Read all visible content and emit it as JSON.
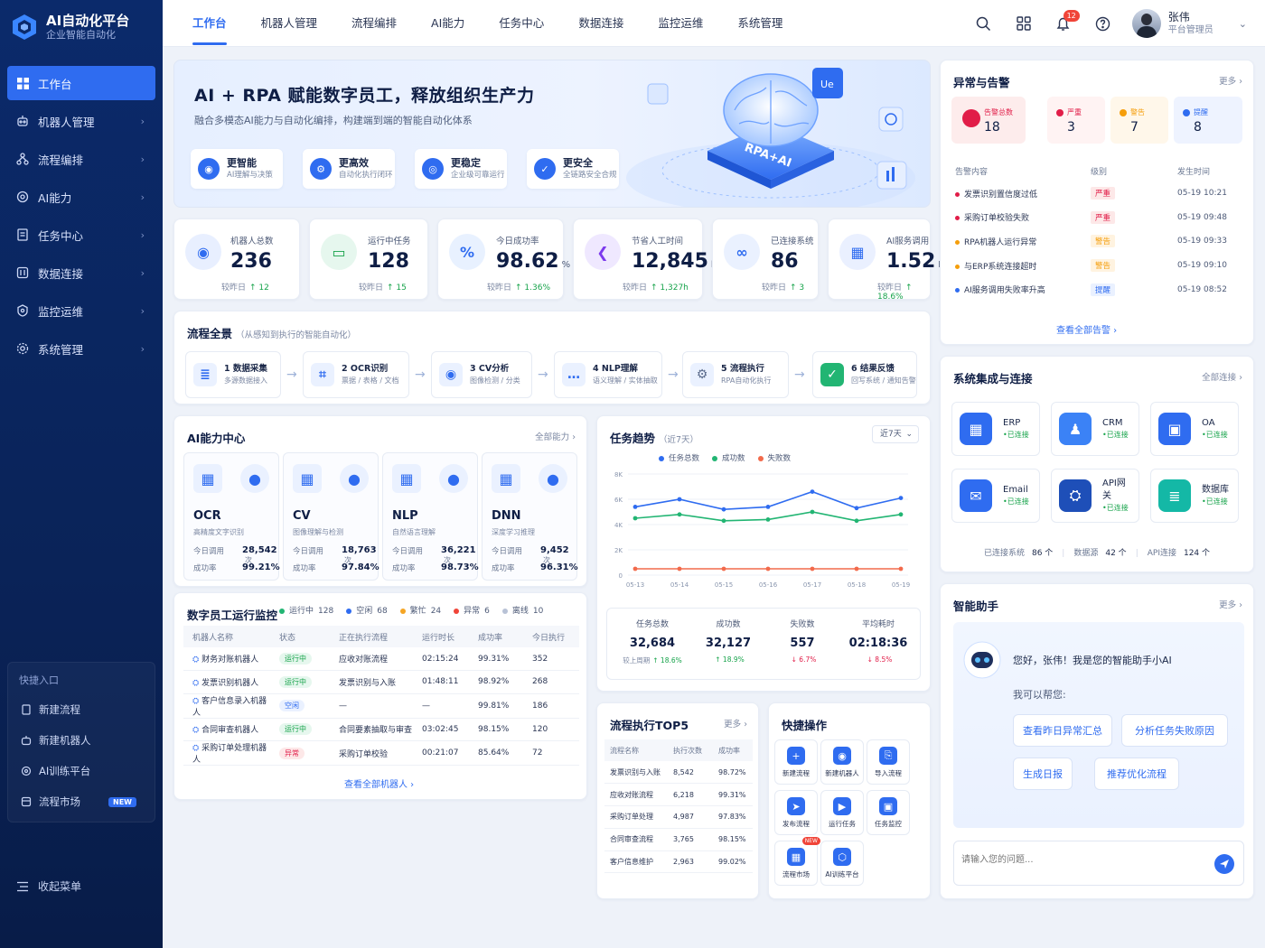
{
  "brand": {
    "title": "AI自动化平台",
    "subtitle": "企业智能自动化"
  },
  "sidebar": {
    "items": [
      {
        "label": "工作台",
        "icon": "dashboard-icon",
        "active": true
      },
      {
        "label": "机器人管理",
        "icon": "robot-icon"
      },
      {
        "label": "流程编排",
        "icon": "workflow-icon"
      },
      {
        "label": "AI能力",
        "icon": "ai-gear-icon"
      },
      {
        "label": "任务中心",
        "icon": "task-icon"
      },
      {
        "label": "数据连接",
        "icon": "data-icon"
      },
      {
        "label": "监控运维",
        "icon": "monitor-icon"
      },
      {
        "label": "系统管理",
        "icon": "settings-icon"
      }
    ],
    "quick_title": "快捷入口",
    "quick": [
      {
        "label": "新建流程"
      },
      {
        "label": "新建机器人"
      },
      {
        "label": "AI训练平台"
      },
      {
        "label": "流程市场",
        "badge": "NEW"
      }
    ],
    "collapse": "收起菜单"
  },
  "topnav": {
    "tabs": [
      "工作台",
      "机器人管理",
      "流程编排",
      "AI能力",
      "任务中心",
      "数据连接",
      "监控运维",
      "系统管理"
    ],
    "notif_count": "12",
    "user_name": "张伟",
    "user_role": "平台管理员"
  },
  "hero": {
    "title": "AI + RPA 赋能数字员工，释放组织生产力",
    "subtitle": "融合多模态AI能力与自动化编排，构建端到端的智能自动化体系",
    "badge": "RPA+AI",
    "chip": "Ue",
    "features": [
      {
        "title": "更智能",
        "desc": "AI理解与决策"
      },
      {
        "title": "更高效",
        "desc": "自动化执行闭环"
      },
      {
        "title": "更稳定",
        "desc": "企业级可靠运行"
      },
      {
        "title": "更安全",
        "desc": "全链路安全合规"
      }
    ]
  },
  "stats": [
    {
      "label": "机器人总数",
      "value": "236",
      "unit": "",
      "cmp": "较昨日",
      "delta": "↑ 12"
    },
    {
      "label": "运行中任务",
      "value": "128",
      "unit": "",
      "cmp": "较昨日",
      "delta": "↑ 15"
    },
    {
      "label": "今日成功率",
      "value": "98.62",
      "unit": "%",
      "cmp": "较昨日",
      "delta": "↑ 1.36%"
    },
    {
      "label": "节省人工时间",
      "value": "12,845",
      "unit": "h",
      "cmp": "较昨日",
      "delta": "↑ 1,327h"
    },
    {
      "label": "已连接系统",
      "value": "86",
      "unit": "",
      "cmp": "较昨日",
      "delta": "↑ 3"
    },
    {
      "label": "AI服务调用",
      "value": "1.52",
      "unit": "M",
      "cmp": "较昨日",
      "delta": "↑ 18.6%"
    }
  ],
  "flow": {
    "title": "流程全景",
    "note": "（从感知到执行的智能自动化）",
    "steps": [
      {
        "title": "1 数据采集",
        "desc": "多源数据接入"
      },
      {
        "title": "2 OCR识别",
        "desc": "票据 / 表格 / 文档"
      },
      {
        "title": "3 CV分析",
        "desc": "图像检测 / 分类"
      },
      {
        "title": "4 NLP理解",
        "desc": "语义理解 / 实体抽取"
      },
      {
        "title": "5 流程执行",
        "desc": "RPA自动化执行"
      },
      {
        "title": "6 结果反馈",
        "desc": "回写系统 / 通知告警"
      }
    ]
  },
  "ai": {
    "title": "AI能力中心",
    "more": "全部能力 ›",
    "today_label": "今日调用",
    "rate_label": "成功率",
    "unit": "次",
    "cards": [
      {
        "name": "OCR",
        "desc": "高精度文字识别",
        "calls": "28,542",
        "rate": "99.21%"
      },
      {
        "name": "CV",
        "desc": "图像理解与检测",
        "calls": "18,763",
        "rate": "97.84%"
      },
      {
        "name": "NLP",
        "desc": "自然语言理解",
        "calls": "36,221",
        "rate": "98.73%"
      },
      {
        "name": "DNN",
        "desc": "深度学习推理",
        "calls": "9,452",
        "rate": "96.31%"
      }
    ]
  },
  "trend": {
    "title": "任务趋势",
    "note": "（近7天）",
    "range": "近7天",
    "legend": [
      "任务总数",
      "成功数",
      "失败数"
    ],
    "summary": [
      {
        "label": "任务总数",
        "value": "32,684",
        "cmp": "较上周期",
        "delta": "↑ 18.6%",
        "up": true
      },
      {
        "label": "成功数",
        "value": "32,127",
        "cmp": "",
        "delta": "↑ 18.9%",
        "up": true
      },
      {
        "label": "失败数",
        "value": "557",
        "cmp": "",
        "delta": "↓ 6.7%",
        "up": false
      },
      {
        "label": "平均耗时",
        "value": "02:18:36",
        "cmp": "",
        "delta": "↓ 8.5%",
        "up": true
      }
    ]
  },
  "chart_data": {
    "type": "line",
    "x": [
      "05-13",
      "05-14",
      "05-15",
      "05-16",
      "05-17",
      "05-18",
      "05-19"
    ],
    "yticks": [
      "0",
      "2K",
      "4K",
      "6K",
      "8K"
    ],
    "ylim": [
      0,
      8000
    ],
    "series": [
      {
        "name": "任务总数",
        "color": "#2f6cf0",
        "values": [
          5400,
          6000,
          5200,
          5400,
          6600,
          5300,
          6100
        ]
      },
      {
        "name": "成功数",
        "color": "#22b573",
        "values": [
          4500,
          4800,
          4300,
          4400,
          5000,
          4300,
          4800
        ]
      },
      {
        "name": "失败数",
        "color": "#f26a4b",
        "values": [
          500,
          500,
          500,
          500,
          500,
          500,
          500
        ]
      }
    ]
  },
  "monitor": {
    "title": "数字员工运行监控",
    "legend": [
      {
        "label": "运行中",
        "count": "128",
        "color": "#22b573"
      },
      {
        "label": "空闲",
        "count": "68",
        "color": "#2f6cf0"
      },
      {
        "label": "繁忙",
        "count": "24",
        "color": "#f5a524"
      },
      {
        "label": "异常",
        "count": "6",
        "color": "#f04438"
      },
      {
        "label": "离线",
        "count": "10",
        "color": "#b8c2d6"
      }
    ],
    "columns": [
      "机器人名称",
      "状态",
      "正在执行流程",
      "运行时长",
      "成功率",
      "今日执行"
    ],
    "rows": [
      {
        "name": "财务对账机器人",
        "status": "运行中",
        "kind": "run",
        "flow": "应收对账流程",
        "time": "02:15:24",
        "rate": "99.31%",
        "count": "352"
      },
      {
        "name": "发票识别机器人",
        "status": "运行中",
        "kind": "run",
        "flow": "发票识别与入账",
        "time": "01:48:11",
        "rate": "98.92%",
        "count": "268"
      },
      {
        "name": "客户信息录入机器人",
        "status": "空闲",
        "kind": "idle",
        "flow": "—",
        "time": "—",
        "rate": "99.81%",
        "count": "186"
      },
      {
        "name": "合同审查机器人",
        "status": "运行中",
        "kind": "run",
        "flow": "合同要素抽取与审查",
        "time": "03:02:45",
        "rate": "98.15%",
        "count": "120"
      },
      {
        "name": "采购订单处理机器人",
        "status": "异常",
        "kind": "err",
        "flow": "采购订单校验",
        "time": "00:21:07",
        "rate": "85.64%",
        "count": "72"
      }
    ],
    "link": "查看全部机器人 ›"
  },
  "top5": {
    "title": "流程执行TOP5",
    "more": "更多 ›",
    "columns": [
      "流程名称",
      "执行次数",
      "成功率"
    ],
    "rows": [
      {
        "name": "发票识别与入账",
        "count": "8,542",
        "rate": "98.72%"
      },
      {
        "name": "应收对账流程",
        "count": "6,218",
        "rate": "99.31%"
      },
      {
        "name": "采购订单处理",
        "count": "4,987",
        "rate": "97.83%"
      },
      {
        "name": "合同审查流程",
        "count": "3,765",
        "rate": "98.15%"
      },
      {
        "name": "客户信息维护",
        "count": "2,963",
        "rate": "99.02%"
      }
    ]
  },
  "quick_ops": {
    "title": "快捷操作",
    "items": [
      {
        "label": "新建流程",
        "icon": "add-file-icon"
      },
      {
        "label": "新建机器人",
        "icon": "robot-icon"
      },
      {
        "label": "导入流程",
        "icon": "import-icon"
      },
      {
        "label": "发布流程",
        "icon": "send-icon"
      },
      {
        "label": "运行任务",
        "icon": "play-icon"
      },
      {
        "label": "任务监控",
        "icon": "monitor-icon"
      },
      {
        "label": "流程市场",
        "icon": "market-icon",
        "badge": "NEW"
      },
      {
        "label": "AI训练平台",
        "icon": "ai-train-icon"
      }
    ]
  },
  "alerts": {
    "title": "异常与告警",
    "more": "更多 ›",
    "boxes": [
      {
        "label": "告警总数",
        "value": "18",
        "color": "#e11d48",
        "bg": "#fdecec"
      },
      {
        "label": "严重",
        "value": "3",
        "color": "#e11d48",
        "bg": "#fff3f3"
      },
      {
        "label": "警告",
        "value": "7",
        "color": "#f59e0b",
        "bg": "#fff7ea"
      },
      {
        "label": "提醒",
        "value": "8",
        "color": "#2f6cf0",
        "bg": "#eef3ff"
      }
    ],
    "columns": [
      "告警内容",
      "级别",
      "发生时间"
    ],
    "rows": [
      {
        "text": "发票识别置信度过低",
        "level": "严重",
        "kind": "crit",
        "time": "05-19  10:21"
      },
      {
        "text": "采购订单校验失败",
        "level": "严重",
        "kind": "crit",
        "time": "05-19  09:48"
      },
      {
        "text": "RPA机器人运行异常",
        "level": "警告",
        "kind": "warn",
        "time": "05-19  09:33"
      },
      {
        "text": "与ERP系统连接超时",
        "level": "警告",
        "kind": "warn",
        "time": "05-19  09:10"
      },
      {
        "text": "AI服务调用失败率升高",
        "level": "提醒",
        "kind": "info",
        "time": "05-19  08:52"
      }
    ],
    "link": "查看全部告警 ›"
  },
  "integration": {
    "title": "系统集成与连接",
    "more": "全部连接 ›",
    "status": "•已连接",
    "items": [
      {
        "name": "ERP",
        "color": "#2f6cf0"
      },
      {
        "name": "CRM",
        "color": "#3b82f6"
      },
      {
        "name": "OA",
        "color": "#2f6cf0"
      },
      {
        "name": "Email",
        "color": "#2f6cf0"
      },
      {
        "name": "API网关",
        "color": "#1e4fb8"
      },
      {
        "name": "数据库",
        "color": "#14b8a6"
      }
    ],
    "summary": [
      {
        "label": "已连接系统",
        "value": "86 个"
      },
      {
        "label": "数据源",
        "value": "42 个"
      },
      {
        "label": "API连接",
        "value": "124 个"
      }
    ]
  },
  "assistant": {
    "title": "智能助手",
    "more": "更多 ›",
    "greeting": "您好，张伟！我是您的智能助手小AI",
    "prompt": "我可以帮您:",
    "chips": [
      "查看昨日异常汇总",
      "分析任务失败原因",
      "生成日报",
      "推荐优化流程"
    ],
    "placeholder": "请输入您的问题..."
  }
}
